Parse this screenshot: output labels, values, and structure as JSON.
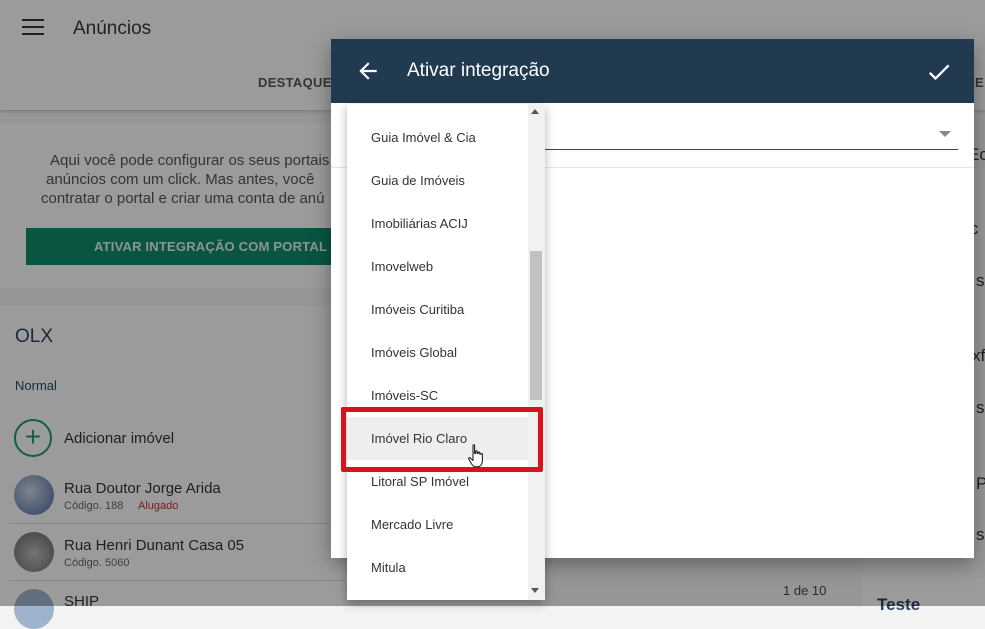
{
  "header": {
    "title": "Anúncios",
    "tab_destaques": "DESTAQUES",
    "tab_right": "E"
  },
  "intro": {
    "lines": [
      "Aqui você pode configurar os seus portais",
      "anúncios com um click. Mas antes, você",
      "contratar o portal e criar uma conta de anú"
    ],
    "button": "ATIVAR INTEGRAÇÃO COM PORTAL"
  },
  "olx": {
    "title": "OLX",
    "subtitle": "Normal",
    "add_label": "Adicionar imóvel",
    "properties": [
      {
        "title": "Rua Doutor Jorge Arida",
        "code": "Código. 188",
        "status": "Alugado"
      },
      {
        "title": "Rua Henri Dunant Casa 05",
        "code": "Código. 5060",
        "status": ""
      },
      {
        "title": "SHIP",
        "code": "",
        "status": ""
      }
    ]
  },
  "right_panel": {
    "fragments": [
      "Ec",
      "ic",
      "s",
      "xf",
      "s",
      "P",
      "s"
    ],
    "bottom": "Teste"
  },
  "pager": "1 de 10",
  "dialog": {
    "title": "Ativar integração",
    "options": [
      "Guia Imóvel & Cia",
      "Guia de Imóveis",
      "Imobiliárias ACIJ",
      "Imovelweb",
      "Imóveis Curitiba",
      "Imóveis Global",
      "Imóveis-SC",
      "Imóvel Rio Claro",
      "Litoral SP Imóvel",
      "Mercado Livre",
      "Mitula"
    ],
    "hovered_index": 7
  },
  "colors": {
    "header": "#213a50",
    "button": "#0f8a6a",
    "highlight": "#d8121e",
    "status": "#c4302b"
  }
}
